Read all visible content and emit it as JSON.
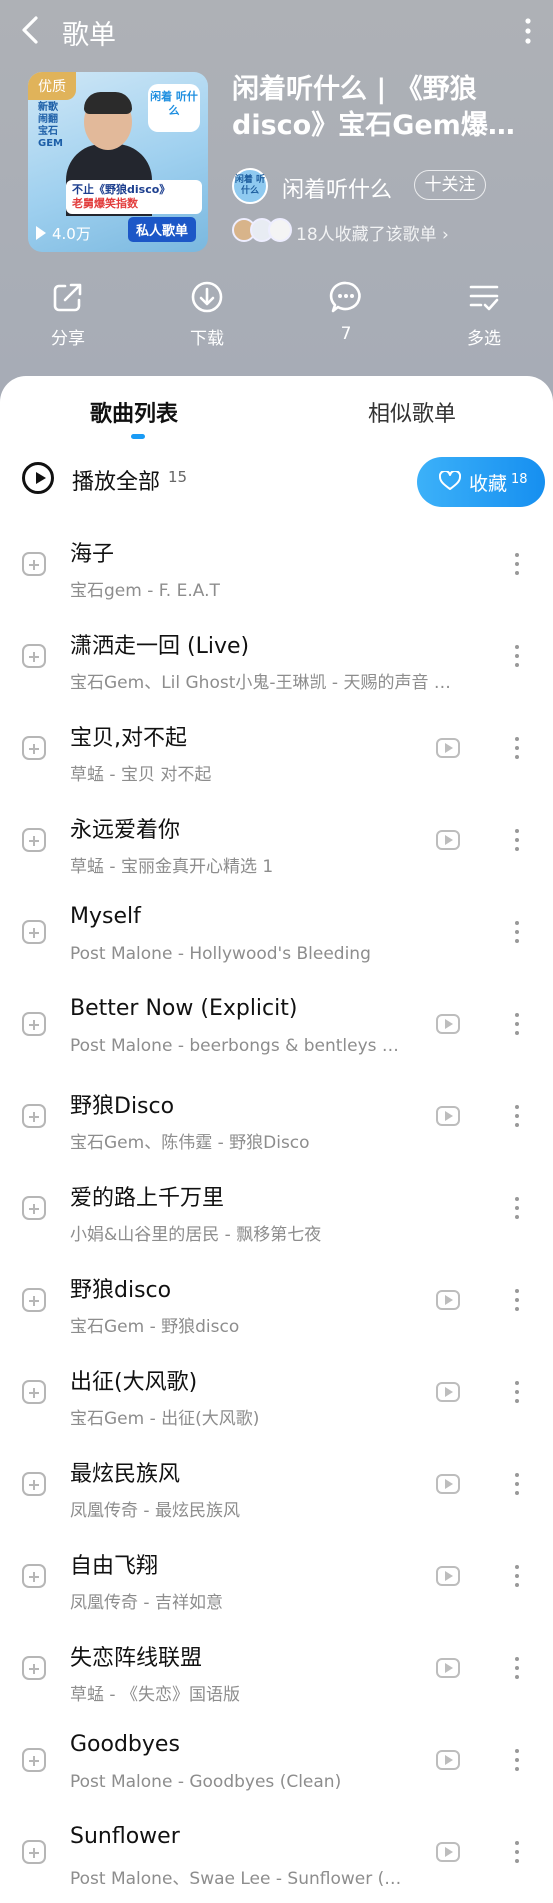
{
  "header": {
    "title": "歌单"
  },
  "playlist": {
    "badge": "优质",
    "cover_sticker": "闲着 听什么",
    "cover_vertical_text": "新歌闹翻 宝石GEM",
    "cover_strip_line1": "不止《野狼disco》",
    "cover_strip_line2": "老舅爆笑指数",
    "cover_private": "私人歌单",
    "play_count": "4.0万",
    "title": "闲着听什么 | 《野狼disco》宝石Gem爆笑…",
    "creator_avatar_text": "闲着 听什么",
    "creator": "闲着听什么",
    "follow_label": "十关注",
    "collected_text": "18人收藏了该歌单 ›"
  },
  "actions": [
    {
      "label": "分享",
      "icon": "share-icon"
    },
    {
      "label": "下载",
      "icon": "download-icon"
    },
    {
      "label": "7",
      "icon": "comment-icon"
    },
    {
      "label": "多选",
      "icon": "multi-select-icon"
    }
  ],
  "tabs": {
    "songs": "歌曲列表",
    "similar": "相似歌单"
  },
  "play_all": {
    "label": "播放全部",
    "count": "15"
  },
  "collect": {
    "label": "收藏",
    "count": "18",
    "color": "#1a9bf5"
  },
  "songs": [
    {
      "name": "海子",
      "sub": "宝石gem - F. E.A.T",
      "mv": false
    },
    {
      "name": "潇洒走一回 (Live)",
      "sub": "宝石Gem、Lil Ghost小鬼-王琳凯 - 天赐的声音 …",
      "mv": false
    },
    {
      "name": "宝贝,对不起",
      "sub": "草蜢 - 宝贝 对不起",
      "mv": true
    },
    {
      "name": "永远爱着你",
      "sub": "草蜢 - 宝丽金真开心精选 1",
      "mv": true
    },
    {
      "name": "Myself",
      "sub": "Post Malone - Hollywood's Bleeding",
      "mv": false
    },
    {
      "name": "Better Now (Explicit)",
      "sub": "Post Malone - beerbongs & bentleys …",
      "mv": true
    },
    {
      "name": "野狼Disco",
      "sub": "宝石Gem、陈伟霆 - 野狼Disco",
      "mv": true
    },
    {
      "name": "爱的路上千万里",
      "sub": "小娟&山谷里的居民 - 飘移第七夜",
      "mv": false
    },
    {
      "name": "野狼disco",
      "sub": "宝石Gem - 野狼disco",
      "mv": true
    },
    {
      "name": "出征(大风歌)",
      "sub": "宝石Gem - 出征(大风歌)",
      "mv": true
    },
    {
      "name": "最炫民族风",
      "sub": "凤凰传奇 - 最炫民族风",
      "mv": true
    },
    {
      "name": "自由飞翔",
      "sub": "凤凰传奇 - 吉祥如意",
      "mv": true
    },
    {
      "name": "失恋阵线联盟",
      "sub": "草蜢 - 《失恋》国语版",
      "mv": true
    },
    {
      "name": "Goodbyes",
      "sub": "Post Malone - Goodbyes (Clean)",
      "mv": true
    },
    {
      "name": "Sunflower",
      "sub": "Post Malone、Swae Lee - Sunflower (…",
      "mv": true
    }
  ]
}
